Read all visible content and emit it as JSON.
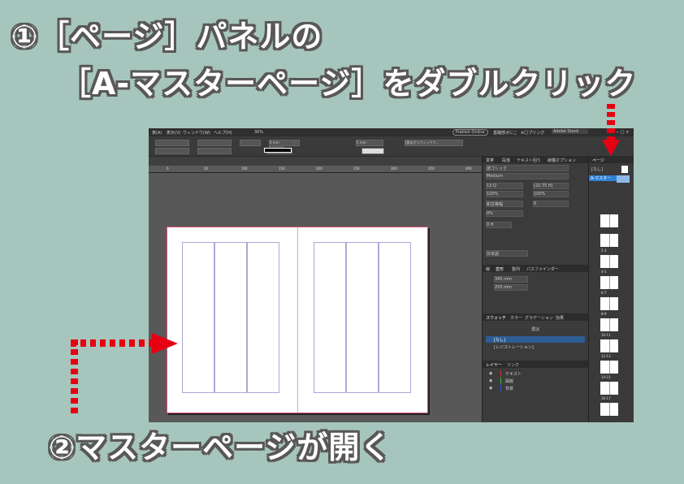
{
  "instruction": {
    "line1": "①［ページ］パネルの",
    "line2": "［A-マスターページ］をダブルクリック",
    "line3": "②マスターページが開く"
  },
  "colors": {
    "background": "#a6c6bd",
    "arrow": "#e60012",
    "title_stroke": "#595757"
  },
  "menubar": {
    "items": [
      "表(A)",
      "表示(V)",
      "ウィンドウ(W)",
      "ヘルプ(H)"
    ],
    "zoom": "30%",
    "publish": "Publish Online",
    "workspace": "基礎部ポにこ",
    "workspace2": "※〇プリング",
    "search_placeholder": "Adobe Stock"
  },
  "control": {
    "stroke_value": "0 mm",
    "scale": "100%",
    "size": "5 mm",
    "style": "[基本グラフィックフ..."
  },
  "ruler": {
    "ticks": [
      "0",
      "50",
      "100",
      "150",
      "200",
      "250",
      "300",
      "350",
      "400"
    ]
  },
  "char_panel": {
    "tabs": [
      "文字",
      "段落",
      "テキスト回り",
      "線種オプション"
    ],
    "font": "游ゴシック",
    "style": "Medium",
    "size": "13 Q",
    "leading": "(22.75 H)",
    "vscale": "100%",
    "hscale": "100%",
    "kern": "和文等幅",
    "track": "0",
    "tsume": "0%",
    "baseline": "0 H",
    "lang": "日本語"
  },
  "transform": {
    "tabs": [
      "線",
      "変形",
      "整列",
      "パスファインダー"
    ],
    "w": "345 mm",
    "h": "255 mm"
  },
  "swatch": {
    "tabs": [
      "スウォッチ",
      "カラー",
      "グラデーション",
      "効果"
    ],
    "tint_label": "濃淡",
    "items": [
      "[なし]",
      "[レジストレーション]"
    ]
  },
  "layers": {
    "tabs": [
      "レイヤー",
      "リンク"
    ],
    "items": [
      "テキスト",
      "図版",
      "背景"
    ]
  },
  "pages": {
    "tab": "ページ",
    "none": "[なし]",
    "master": "A-マスター",
    "spreads": [
      "2-3",
      "4-5",
      "6-7",
      "8-9",
      "10-11",
      "12-13",
      "14-15",
      "16-17"
    ]
  }
}
